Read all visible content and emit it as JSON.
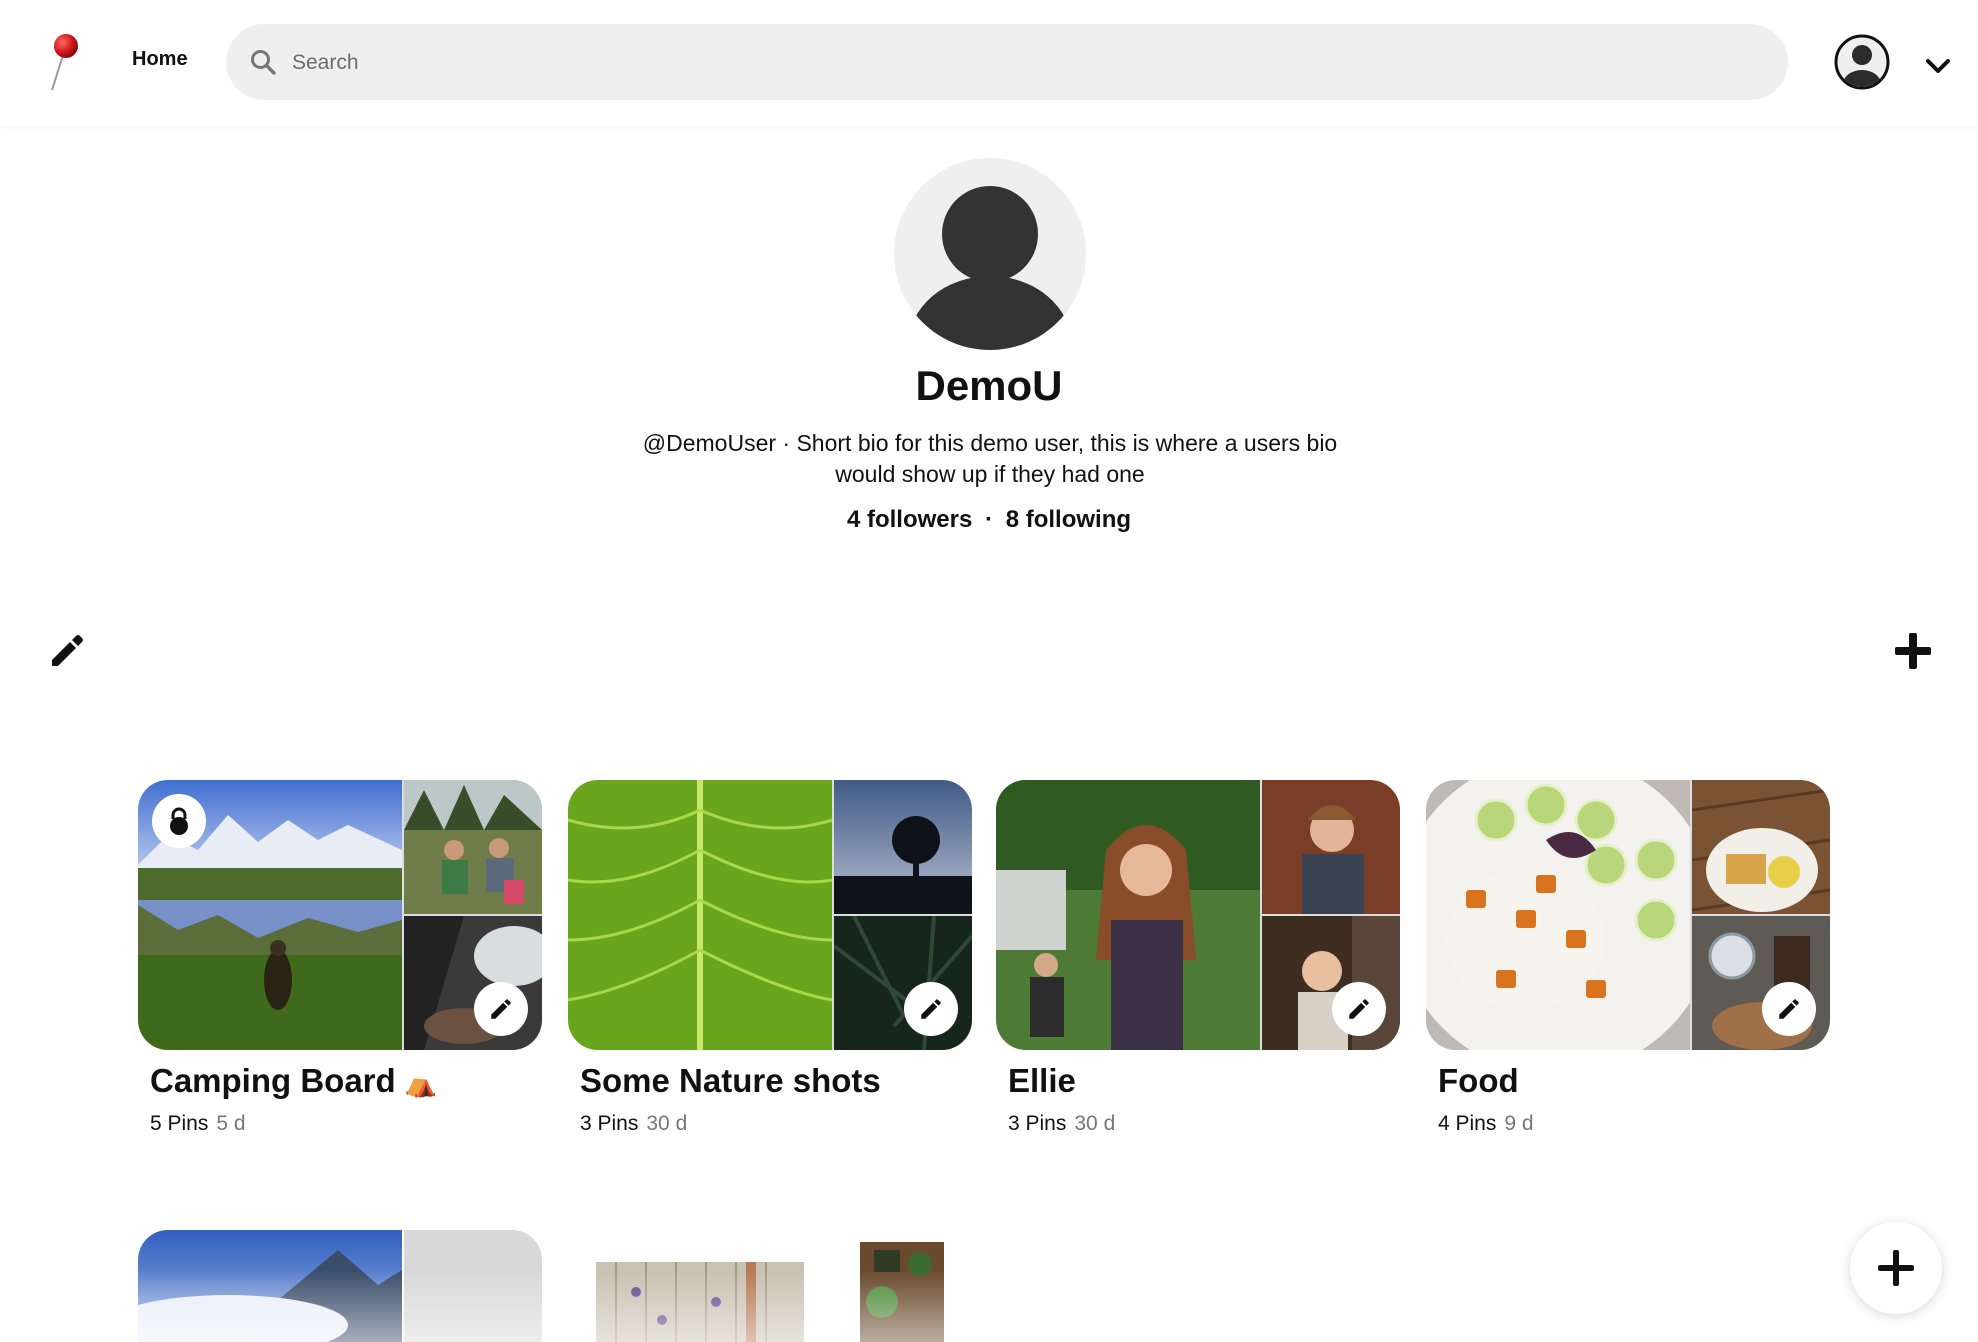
{
  "header": {
    "home_label": "Home",
    "search_placeholder": "Search"
  },
  "profile": {
    "name": "DemoU",
    "bio": "@DemoUser · Short bio for this demo user, this is where a users bio would show up if they had one",
    "followers": "4 followers",
    "separator": "·",
    "following": "8 following"
  },
  "boards": [
    {
      "title": "Camping Board",
      "emoji": "⛺",
      "pins": "5 Pins",
      "age": "5 d",
      "secret": true
    },
    {
      "title": "Some Nature shots",
      "emoji": "",
      "pins": "3 Pins",
      "age": "30 d",
      "secret": false
    },
    {
      "title": "Ellie",
      "emoji": "",
      "pins": "3 Pins",
      "age": "30 d",
      "secret": false
    },
    {
      "title": "Food",
      "emoji": "",
      "pins": "4 Pins",
      "age": "9 d",
      "secret": false
    }
  ],
  "icons": {
    "logo": "pushpin-icon",
    "search": "search-icon",
    "avatar": "user-avatar-icon",
    "chevron": "chevron-down-icon",
    "edit": "pencil-icon",
    "add": "plus-icon",
    "lock": "lock-icon"
  },
  "colors": {
    "brand_red": "#d0171c",
    "search_bg": "#efefef",
    "text": "#111111",
    "muted": "#777777"
  }
}
